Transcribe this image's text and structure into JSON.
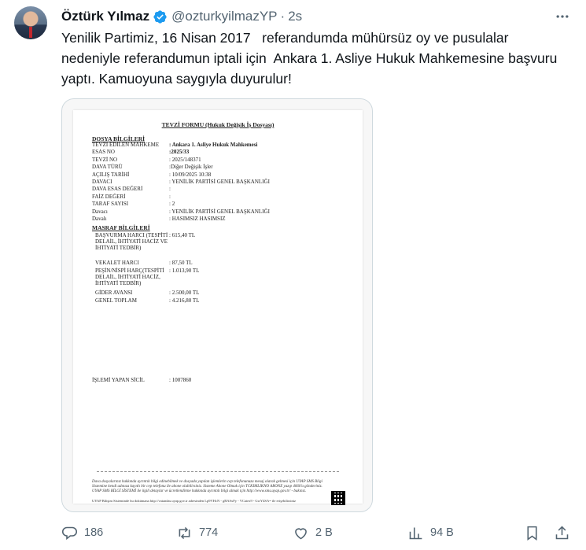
{
  "tweet": {
    "author_name": "Öztürk Yılmaz",
    "handle": "@ozturkyilmazYP",
    "separator": "·",
    "time": "2s",
    "text": "Yenilik Partimiz, 16 Nisan 2017   referandumda mühürsüz oy ve pusulalar nedeniyle referandumun iptali için  Ankara 1. Asliye Hukuk Mahkemesine başvuru yaptı. Kamuoyuna saygıyla duyurulur!"
  },
  "document": {
    "title": "TEVZİ FORMU (Hukuk Değişik İş Dosyası)",
    "dosya_section": "DOSYA BİLGİLERİ",
    "dosya_rows": [
      {
        "k": "TEVZİ EDİLEN MAHKEME",
        "v": ": Ankara 1. Asliye Hukuk Mahkemesi"
      },
      {
        "k": "ESAS NO",
        "v": ":2025/33"
      },
      {
        "k": "TEVZİ NO",
        "v": ": 2025/148371"
      },
      {
        "k": "DAVA TÜRÜ",
        "v": ":Diğer Değişik İşler"
      },
      {
        "k": "AÇILIŞ TARİHİ",
        "v": ": 10/09/2025  10:38"
      },
      {
        "k": "DAVACI",
        "v": ": YENİLİK PARTİSİ GENEL BAŞKANLIĞI"
      },
      {
        "k": "DAVA ESAS DEĞERİ",
        "v": ":"
      },
      {
        "k": "FAİZ DEĞERİ",
        "v": ":"
      },
      {
        "k": "TARAF SAYISI",
        "v": ": 2"
      },
      {
        "k": "Davacı",
        "v": ": YENİLİK PARTİSİ GENEL BAŞKANLIĞI"
      },
      {
        "k": "Davalı",
        "v": ": HASIMSIZ HASIMSIZ"
      }
    ],
    "masraf_section": "MASRAF BİLGİLERİ",
    "masraf_rows": [
      {
        "k": "BAŞVURMA HARCI (TESPİTİ DELAİL, İHTİYATİ HACİZ VE İHTİYATİ TEDBİR)",
        "v": ": 615,40 TL"
      },
      {
        "k": "VEKALET HARCI",
        "v": ": 87,50 TL"
      },
      {
        "k": "PEŞİN/NİSPİ HARÇ(TESPİTİ DELAİL, İHTİYATİ HACİZ, İHTİYATİ TEDBİR)",
        "v": ": 1.013,90 TL"
      },
      {
        "k": "GİDER AVANSI",
        "v": ": 2.500,00 TL"
      },
      {
        "k": "GENEL TOPLAM",
        "v": ": 4.216,80 TL"
      }
    ],
    "islem_label": "İŞLEMİ YAPAN SİCİL",
    "islem_value": ": 1007860",
    "footer_note": "Dava dosyalarınız hakkında ayrıntılı bilgi edinebilmek ve dosyada yapılan işlemlerin cep telefonunuza mesaj olarak gelmesi için UYAP SMS Bilgi Sistemine kendi adınıza kayıtlı bir cep telefonu ile abone olabilirsiniz. Sisteme Abone Olmak için TCKIMLIKNO ABONE yazıp 4060'a gönderiniz. UYAP SMS BİLGİ SİSTEMİ ile ilgili detaylar ve ücretlendirme hakkında ayrıntılı bilgi almak için http://www.sms.uyap.gov.tr/ - bakınız.",
    "footer_code": "UYAP Bilişim Sisteminde bu dokümana http://vatandas.uyap.gov.tr adresinden  Lp9VHcN - gBASxFy - VCatex9 - GwY4SA= ile erişebilirsiniz"
  },
  "actions": {
    "replies": "186",
    "reposts": "774",
    "likes": "2 B",
    "views": "94 B"
  },
  "colors": {
    "verified": "#1d9bf0",
    "muted": "#536471",
    "text": "#0f1419"
  },
  "icons": [
    "verified-badge-icon",
    "more-icon",
    "reply-icon",
    "repost-icon",
    "like-icon",
    "views-icon",
    "bookmark-icon",
    "share-icon"
  ]
}
